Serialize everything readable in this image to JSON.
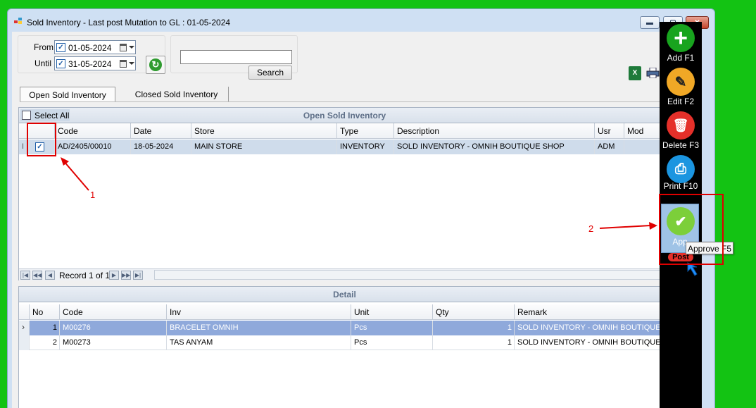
{
  "window": {
    "title": "Sold Inventory - Last post Mutation to GL : 01-05-2024",
    "min_label": "▬",
    "max_label": "▢",
    "close_label": "✕"
  },
  "filters": {
    "from_label": "From",
    "from_value": "01-05-2024",
    "until_label": "Until",
    "until_value": "31-05-2024",
    "search_value": "",
    "search_label": "Search",
    "excel_label": "X"
  },
  "tabs": [
    {
      "label": "Open Sold Inventory",
      "active": true
    },
    {
      "label": "Closed Sold Inventory",
      "active": false
    }
  ],
  "open_grid": {
    "title": "Open Sold Inventory",
    "select_all_label": "Select All",
    "columns": [
      "Code",
      "Date",
      "Store",
      "Type",
      "Description",
      "Usr",
      "Mod"
    ],
    "rows": [
      {
        "code": "AD/2405/00010",
        "date": "18-05-2024",
        "store": "MAIN STORE",
        "type": "INVENTORY",
        "description": "SOLD INVENTORY - OMNIH BOUTIQUE SHOP",
        "usr": "ADM",
        "mod": "",
        "checked": true
      }
    ],
    "row_indicator": "I",
    "record_text": "Record 1 of 1"
  },
  "detail_grid": {
    "title": "Detail",
    "columns": [
      "No",
      "Code",
      "Inv",
      "Unit",
      "Qty",
      "Remark"
    ],
    "rows": [
      {
        "no": "1",
        "code": "M00276",
        "inv": "BRACELET OMNIH",
        "unit": "Pcs",
        "qty": "1",
        "remark": "SOLD INVENTORY - OMNIH BOUTIQUE S...",
        "selected": true
      },
      {
        "no": "2",
        "code": "M00273",
        "inv": "TAS ANYAM",
        "unit": "Pcs",
        "qty": "1",
        "remark": "SOLD INVENTORY - OMNIH BOUTIQUE S...",
        "selected": false
      }
    ],
    "row_indicator": "›"
  },
  "side_panel": [
    {
      "label": "Add F1",
      "icon": "plus-icon",
      "glyph": "+",
      "color": "#18a41e"
    },
    {
      "label": "Edit F2",
      "icon": "edit-icon",
      "glyph": "✎",
      "color": "#f0a826"
    },
    {
      "label": "Delete F3",
      "icon": "trash-icon",
      "glyph": "🗑",
      "color": "#e5302a"
    },
    {
      "label": "Print F10",
      "icon": "printer-icon",
      "glyph": "⎙",
      "color": "#1b95e0"
    },
    {
      "label": "Approve F5",
      "short_label": "App",
      "icon": "check-icon",
      "glyph": "✔",
      "color": "#7ccf3a"
    },
    {
      "label": "Post",
      "icon": "post-icon",
      "color": "#e5302a"
    }
  ],
  "tooltip": "Approve F5",
  "annotations": {
    "num1": "1",
    "num2": "2",
    "color": "#e00000"
  }
}
